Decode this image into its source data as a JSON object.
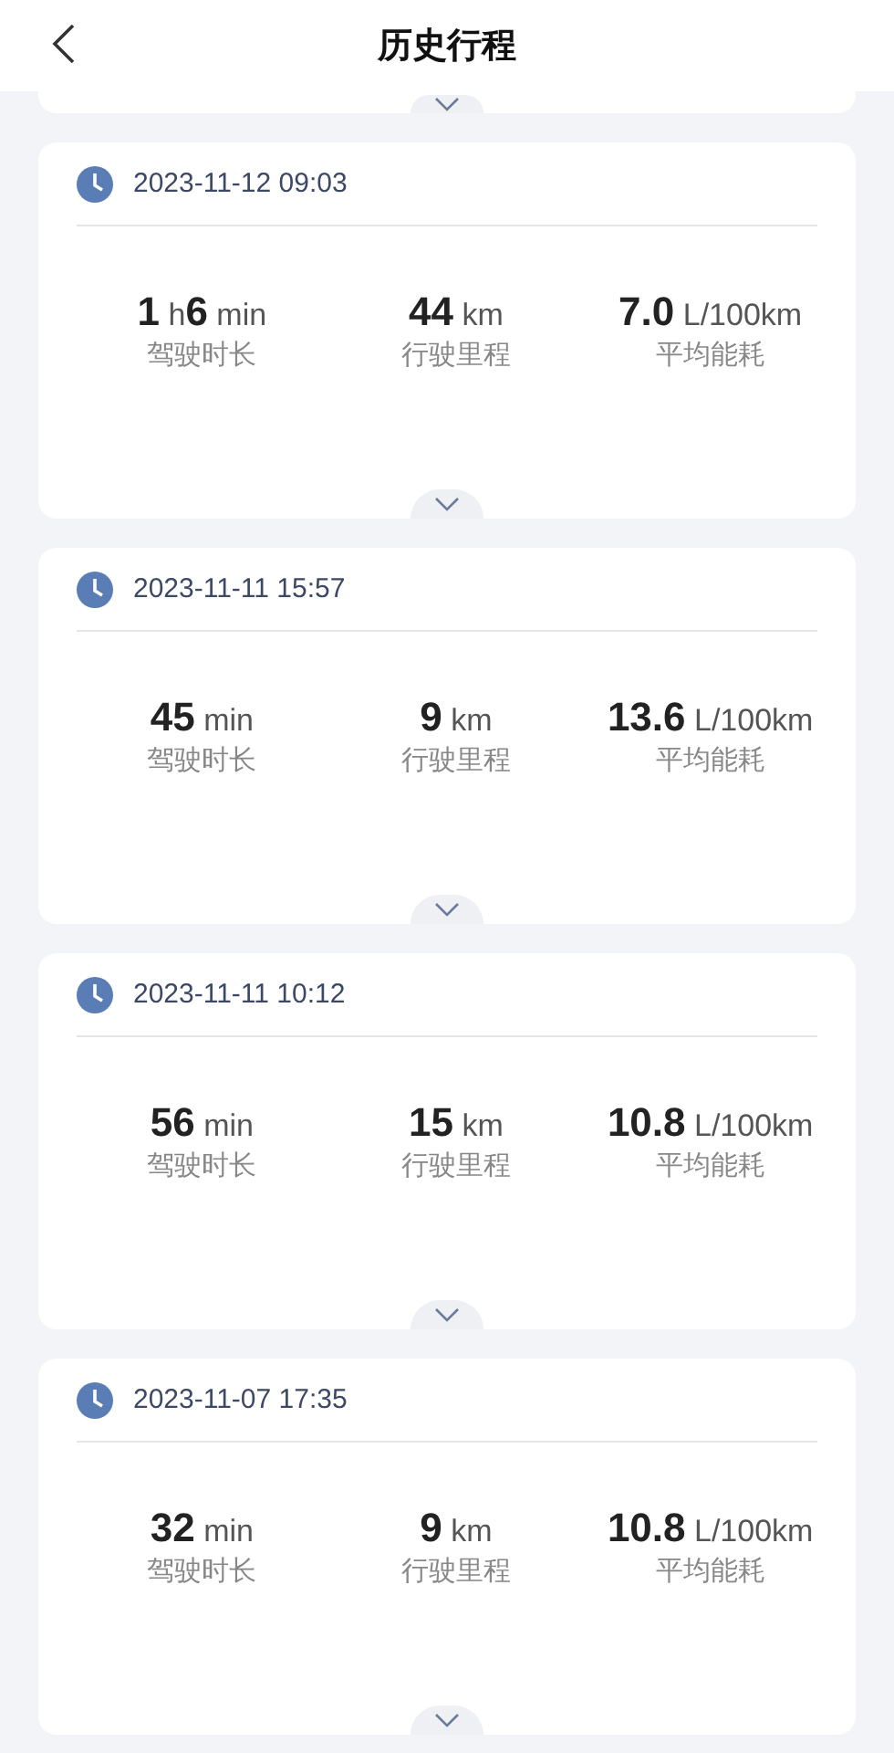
{
  "header": {
    "title": "历史行程"
  },
  "trips": [
    {
      "datetime": "2023-11-12 09:03",
      "metrics": [
        {
          "value": "**1** h**6** min",
          "label": "驾驶时长"
        },
        {
          "value": "**44** km",
          "label": "行驶里程"
        },
        {
          "value": "**7.0** L/100km",
          "label": "平均能耗"
        }
      ]
    },
    {
      "datetime": "2023-11-11 15:57",
      "metrics": [
        {
          "value": "**45** min",
          "label": "驾驶时长"
        },
        {
          "value": "**9** km",
          "label": "行驶里程"
        },
        {
          "value": "**13.6** L/100km",
          "label": "平均能耗"
        }
      ]
    },
    {
      "datetime": "2023-11-11 10:12",
      "metrics": [
        {
          "value": "**56** min",
          "label": "驾驶时长"
        },
        {
          "value": "**15** km",
          "label": "行驶里程"
        },
        {
          "value": "**10.8** L/100km",
          "label": "平均能耗"
        }
      ]
    },
    {
      "datetime": "2023-11-07 17:35",
      "metrics": [
        {
          "value": "**32** min",
          "label": "驾驶时长"
        },
        {
          "value": "**9** km",
          "label": "行驶里程"
        },
        {
          "value": "**10.8** L/100km",
          "label": "平均能耗"
        }
      ]
    }
  ]
}
